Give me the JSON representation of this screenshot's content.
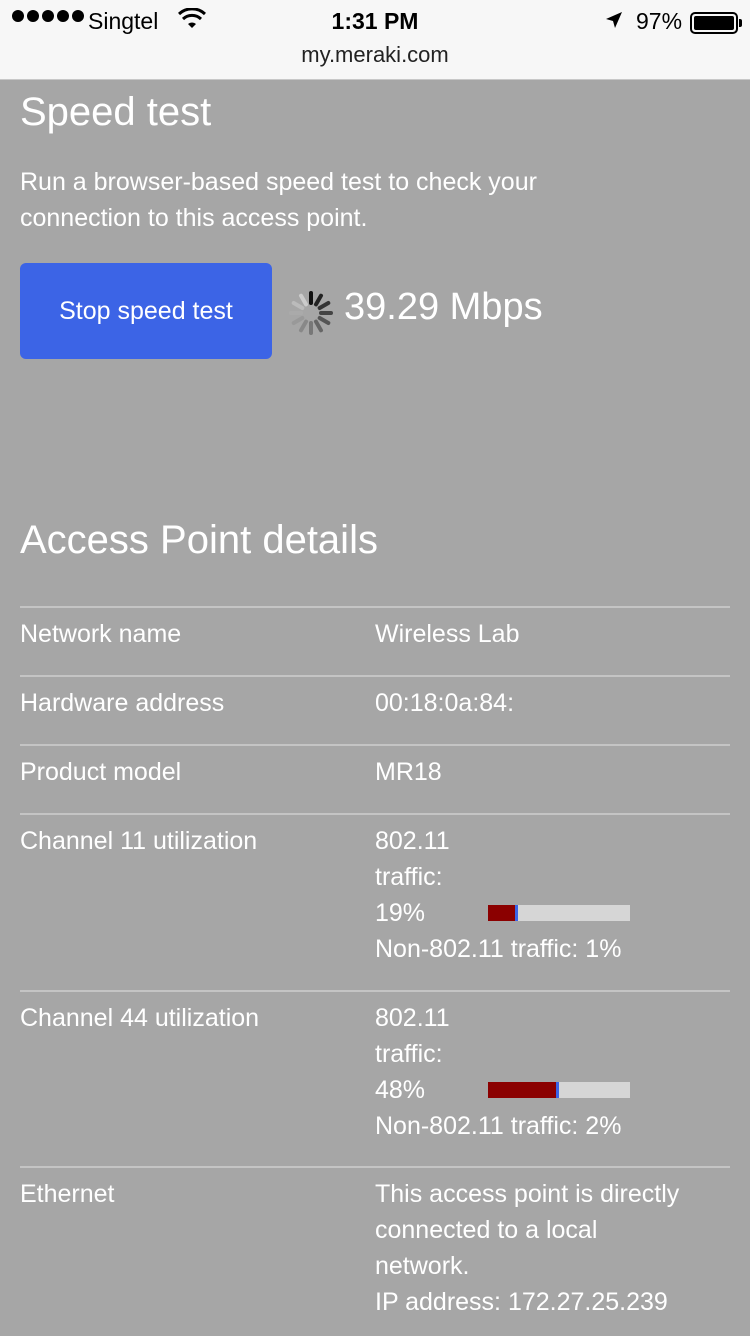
{
  "status_bar": {
    "carrier": "Singtel",
    "time": "1:31 PM",
    "battery": "97%",
    "url": "my.meraki.com"
  },
  "speed_test": {
    "title": "Speed test",
    "description": "Run a browser-based speed test to check your connection to this access point.",
    "button_label": "Stop speed test",
    "result": "39.29 Mbps"
  },
  "ap_details": {
    "title": "Access Point details",
    "network_name": {
      "label": "Network name",
      "value": "Wireless Lab"
    },
    "hardware_address": {
      "label": "Hardware address",
      "value": "00:18:0a:84:"
    },
    "product_model": {
      "label": "Product model",
      "value": "MR18"
    },
    "channel11": {
      "label": "Channel 11 utilization",
      "traffic_line1": "802.11",
      "traffic_line2": "traffic:",
      "percent": "19%",
      "utilization": 0.19,
      "non80211": "Non-802.11 traffic: 1%"
    },
    "channel44": {
      "label": "Channel 44 utilization",
      "traffic_line1": "802.11",
      "traffic_line2": "traffic:",
      "percent": "48%",
      "utilization": 0.48,
      "non80211": "Non-802.11 traffic: 2%"
    },
    "ethernet": {
      "label": "Ethernet",
      "line1": "This access point is directly",
      "line2": "connected to a local",
      "line3": "network.",
      "ip": "IP address: 172.27.25.239"
    }
  },
  "colors": {
    "background": "#a6a6a6",
    "button": "#3c64e6",
    "bar_fill": "#8b0000",
    "bar_track": "#d6d6d6"
  }
}
